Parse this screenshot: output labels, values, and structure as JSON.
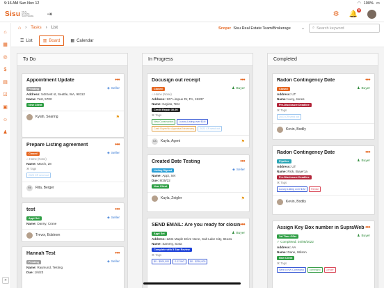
{
  "status": {
    "time": "9:16 AM",
    "date": "Sun Nov 12",
    "battery": "100%"
  },
  "app": {
    "logo_text": "Sisu",
    "logo_tagline": "REAL ESTATE SOFTWARE",
    "notifications": "9"
  },
  "breadcrumb": {
    "section": "Tasks",
    "page": "List"
  },
  "scope": {
    "label": "Scope:",
    "value": "Sisu Real Estate Team/Brokerage"
  },
  "search": {
    "placeholder": "Search keyword"
  },
  "tabs": [
    "List",
    "Board",
    "Calendar"
  ],
  "columns": [
    {
      "title": "To Do",
      "cards": [
        {
          "title": "Appointment Update",
          "status": "Pending",
          "status_color": "#9e9e9e",
          "role": "Seller",
          "lines": [
            {
              "k": "Address:",
              "v": "548 test st, Seattle, WA, 98112"
            },
            {
              "k": "Name:",
              "v": "Test, 5700"
            }
          ],
          "tags": [
            {
              "t": "New Client",
              "fill": "#2e9e44"
            }
          ],
          "assignee": "Kylah, Searing",
          "flag": true,
          "avatar": "photo"
        },
        {
          "title": "Prepare Listing agreement",
          "status": "Closed",
          "status_color": "#e5651f",
          "role": "Seller",
          "lines": [
            {
              "k": "",
              "v": "Home (None)",
              "muted": true
            },
            {
              "k": "Name:",
              "v": "March, 28"
            }
          ],
          "tag_label": "Tags",
          "tags": [
            {
              "t": "2023 CR send out",
              "outline": "#a0c8f0"
            }
          ],
          "assignee": "Rita, Berger",
          "avatar": "RB"
        },
        {
          "title": "test",
          "status": "Appt Set",
          "status_color": "#2e9e44",
          "role": "Seller",
          "lines": [
            {
              "k": "Name:",
              "v": "Danny, Crane"
            }
          ],
          "tags": [],
          "assignee": "Trevor, Edstrom",
          "avatar": "photo"
        },
        {
          "title": "Hannah Test",
          "status": "Pending",
          "status_color": "#9e9e9e",
          "role": "Seller",
          "lines": [
            {
              "k": "Name:",
              "v": "Raymund, Testing"
            },
            {
              "k": "Due:",
              "v": "1/6/23"
            }
          ],
          "tags": [],
          "assignee": "",
          "avatar": ""
        }
      ]
    },
    {
      "title": "In Progress",
      "cards": [
        {
          "title": "Docusign out receipt",
          "status": "Closed",
          "status_color": "#e5651f",
          "role": "Buyer",
          "lines": [
            {
              "k": "",
              "v": "Home (None)",
              "muted": true
            },
            {
              "k": "Address:",
              "v": "127 Limpue Dr, PA, 15237"
            },
            {
              "k": "Name:",
              "v": "Kaylas, Test"
            }
          ],
          "tags_top": [
            {
              "t": "Credit Repair 30-90",
              "fill": "#222"
            }
          ],
          "tag_label": "Tags",
          "tags": [
            {
              "t": "New Construction",
              "outline": "#3a9e4a"
            },
            {
              "t": "Luxury Listing over $1M",
              "outline": "#3a5bd5"
            },
            {
              "t": "Cash Buyer/No Appraisal Necessary",
              "outline": "#e09a3a"
            },
            {
              "t": "2023 CR send out",
              "outline": "#a0c8f0"
            }
          ],
          "assignee": "Kayla, Agent",
          "flag": true,
          "avatar": "KA"
        },
        {
          "title": "Created Date Testing",
          "status": "Listing Signed",
          "status_color": "#2a9fd6",
          "role": "Seller",
          "lines": [
            {
              "k": "Name:",
              "v": "Appt, Set"
            },
            {
              "k": "Due:",
              "v": "8/25/22"
            }
          ],
          "tags": [
            {
              "t": "New Client",
              "fill": "#2e9e44"
            }
          ],
          "assignee": "Kayla, Zeigler",
          "flag": true,
          "avatar": "photo"
        },
        {
          "title": "SEND EMAIL: Are you ready for closing?",
          "status": "Appt Set",
          "status_color": "#2e9e44",
          "role": "Buyer",
          "lines": [
            {
              "k": "Address:",
              "v": "1234 Maple Drive None, Salt Lake City, 84121"
            },
            {
              "k": "Name:",
              "v": "Sammy, Sosa"
            }
          ],
          "tags_top": [
            {
              "t": "Complete with 5 Star Review",
              "fill": "#1a3fd8"
            }
          ],
          "tag_label": "Tags",
          "tags": [
            {
              "t": "$0 - $500,000",
              "outline": "#3a5bd5"
            },
            {
              "t": "0-12 MO",
              "outline": "#3a5bd5"
            },
            {
              "t": "$0 - $250,000",
              "outline": "#3a5bd5"
            }
          ],
          "assignee": "",
          "avatar": ""
        }
      ]
    },
    {
      "title": "Completed",
      "cards": [
        {
          "title": "Radon Contingency Date",
          "status": "Closed",
          "status_color": "#e5651f",
          "role": "Buyer",
          "lines": [
            {
              "k": "Address:",
              "v": "UT"
            },
            {
              "k": "Name:",
              "v": "Lucy, Jones"
            }
          ],
          "tags_top": [
            {
              "t": "Pre-Disclosure Deadline",
              "fill": "#b3263a"
            }
          ],
          "tag_label": "Tags",
          "tags": [
            {
              "t": "2023 CR send out",
              "outline": "#a0c8f0"
            }
          ],
          "assignee": "Kevin, Bodily",
          "avatar": "photo"
        },
        {
          "title": "Radon Contingency Date",
          "status": "Pipeline",
          "status_color": "#2aa5b5",
          "role": "Buyer",
          "lines": [
            {
              "k": "Address:",
              "v": "UT"
            },
            {
              "k": "Name:",
              "v": "Rick, Buyer1a"
            }
          ],
          "tags_top": [
            {
              "t": "Pre-Disclosure Deadline",
              "fill": "#b3263a"
            }
          ],
          "tag_label": "Tags",
          "tags": [
            {
              "t": "Luxury Listing over $1M",
              "outline": "#3a5bd5"
            },
            {
              "t": "Rental",
              "outline": "#d94a5a"
            }
          ],
          "assignee": "Kevin, Bodily",
          "avatar": "photo"
        },
        {
          "title": "Assign Key Box number in SupraWeb",
          "status": "1st Time Offer",
          "status_color": "#2e9e44",
          "role": "Buyer",
          "lines": [
            {
              "k": "",
              "v": "Completed: 04/08/2022",
              "done": true
            },
            {
              "k": "Address:",
              "v": "AA"
            },
            {
              "k": "Name:",
              "v": "Dane, Wilson"
            }
          ],
          "tags": [
            {
              "t": "New Client",
              "fill": "#2e9e44"
            }
          ],
          "tag_label": "Tags",
          "tags2": [
            {
              "t": "Sent to KW Command",
              "outline": "#3a5bd5"
            },
            {
              "t": "command",
              "outline": "#3a9e4a"
            },
            {
              "t": "Lender",
              "outline": "#d94a5a"
            }
          ],
          "assignee": "",
          "avatar": ""
        }
      ]
    }
  ]
}
